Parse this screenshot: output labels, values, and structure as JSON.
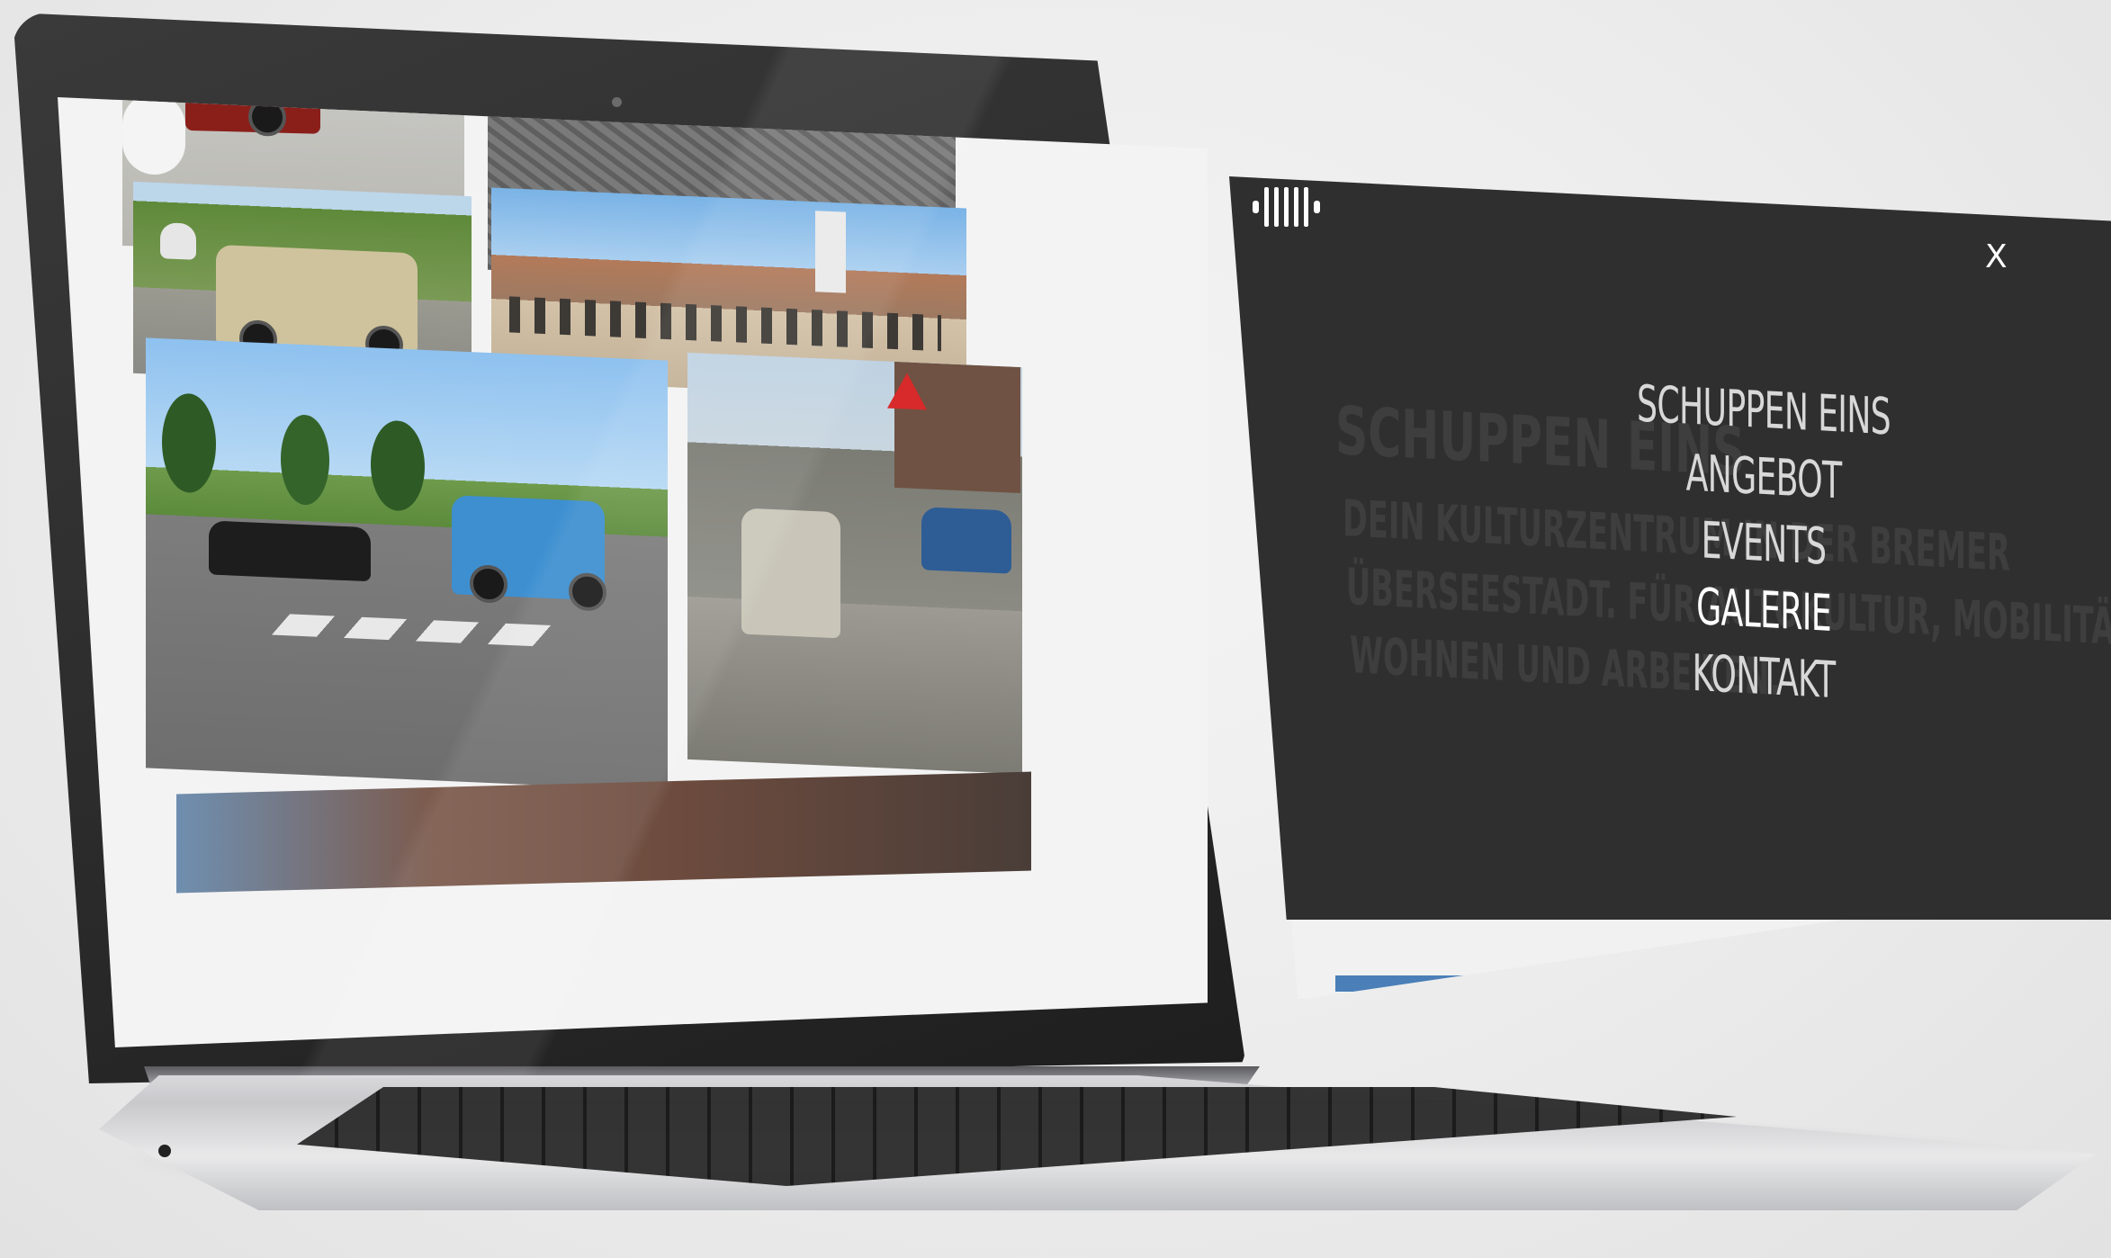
{
  "menu": {
    "items": [
      {
        "label": "SCHUPPEN EINS"
      },
      {
        "label": "ANGEBOT"
      },
      {
        "label": "EVENTS"
      },
      {
        "label": "GALERIE",
        "active": true
      },
      {
        "label": "KONTAKT"
      }
    ],
    "close_label": "X",
    "active_color": "#ffffff",
    "overlay_color": "#2f2f2f"
  },
  "background_hero": {
    "title": "SCHUPPEN EINS",
    "subtitle_lines": [
      "DEIN KULTURZENTRUM IN DER BREMER",
      "ÜBERSEESTADT. FÜR AUTOKULTUR, MOBILITÄT,",
      "WOHNEN UND ARBEITEN."
    ]
  },
  "logo": {
    "name": "schuppen-eins-logo-icon"
  },
  "gallery": {
    "photos": [
      {
        "name": "photo-cars-concrete"
      },
      {
        "name": "photo-cobblestones"
      },
      {
        "name": "photo-mercedes-convertible"
      },
      {
        "name": "photo-event-crowd"
      },
      {
        "name": "photo-porsche-2cv-road"
      },
      {
        "name": "photo-street-vintage-car"
      },
      {
        "name": "photo-bottom-building"
      }
    ]
  }
}
